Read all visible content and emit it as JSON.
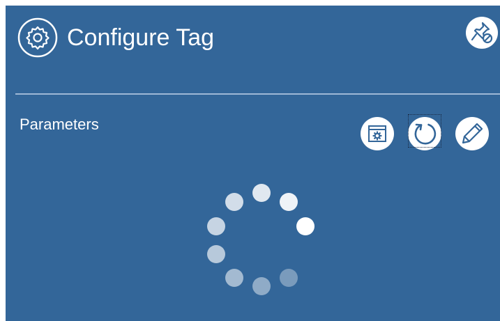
{
  "header": {
    "title": "Configure Tag",
    "icon": "gear-icon",
    "unpin_icon": "unpin-icon"
  },
  "section": {
    "label": "Parameters"
  },
  "toolbar": {
    "buttons": [
      {
        "name": "settings-window-button",
        "icon": "settings-window-icon"
      },
      {
        "name": "refresh-button",
        "icon": "refresh-icon"
      },
      {
        "name": "edit-button",
        "icon": "pencil-icon"
      }
    ]
  },
  "colors": {
    "panel_bg": "#336699",
    "foreground": "#ffffff",
    "divider": "#9fb8d6"
  }
}
